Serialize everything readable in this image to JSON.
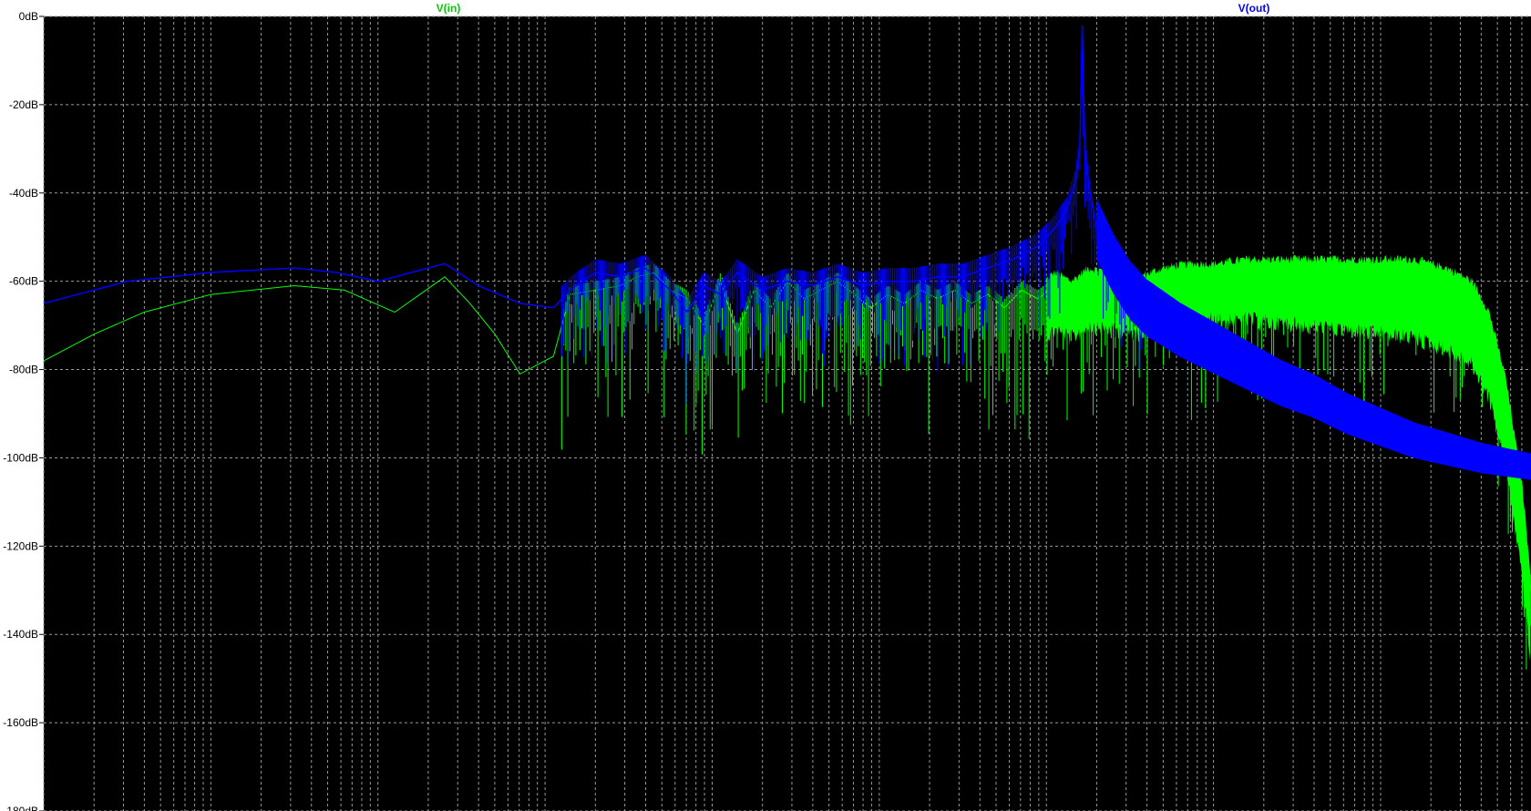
{
  "window": {
    "background": "#ffffff",
    "plot_background": "#000000",
    "grid_color": "#9a9a9a"
  },
  "chart_data": {
    "type": "line",
    "title": "",
    "xlabel": "",
    "ylabel": "",
    "x_scale": "log",
    "x_decade_range": [
      0,
      8.9
    ],
    "ylim": [
      -180,
      0
    ],
    "y_ticks": [
      0,
      -20,
      -40,
      -60,
      -80,
      -100,
      -120,
      -140,
      -160,
      -180
    ],
    "y_tick_labels": [
      "0dB",
      "-20dB",
      "-40dB",
      "-60dB",
      "-80dB",
      "-100dB",
      "-120dB",
      "-140dB",
      "-160dB",
      "-180dB"
    ],
    "grid": true,
    "series": [
      {
        "name": "V(in)",
        "color": "#00ff00",
        "points": [
          [
            0.0,
            -78
          ],
          [
            0.3,
            -72
          ],
          [
            0.6,
            -67
          ],
          [
            1.0,
            -63
          ],
          [
            1.5,
            -61
          ],
          [
            1.8,
            -62
          ],
          [
            2.1,
            -67
          ],
          [
            2.25,
            -63
          ],
          [
            2.4,
            -59
          ],
          [
            2.55,
            -65
          ],
          [
            2.7,
            -72
          ],
          [
            2.85,
            -81
          ],
          [
            2.95,
            -79
          ],
          [
            3.05,
            -77
          ],
          [
            3.15,
            -63
          ],
          [
            3.3,
            -62
          ],
          [
            3.45,
            -61
          ],
          [
            3.55,
            -59
          ],
          [
            3.65,
            -58
          ],
          [
            3.75,
            -62
          ],
          [
            3.85,
            -64
          ],
          [
            3.95,
            -70
          ],
          [
            4.05,
            -60
          ],
          [
            4.15,
            -72
          ],
          [
            4.25,
            -62
          ],
          [
            4.35,
            -66
          ],
          [
            4.45,
            -60
          ],
          [
            4.55,
            -64
          ],
          [
            4.65,
            -62
          ],
          [
            4.75,
            -60
          ],
          [
            4.85,
            -63
          ],
          [
            4.95,
            -66
          ],
          [
            5.05,
            -63
          ],
          [
            5.15,
            -65
          ],
          [
            5.25,
            -62
          ],
          [
            5.35,
            -64
          ],
          [
            5.45,
            -62
          ],
          [
            5.55,
            -65
          ],
          [
            5.65,
            -63
          ],
          [
            5.75,
            -66
          ],
          [
            5.85,
            -62
          ],
          [
            5.95,
            -64
          ],
          [
            6.05,
            -61
          ],
          [
            6.15,
            -63
          ],
          [
            6.25,
            -60
          ],
          [
            6.4,
            -61
          ],
          [
            6.55,
            -62
          ],
          [
            6.7,
            -60
          ],
          [
            6.85,
            -59
          ],
          [
            7.0,
            -59
          ],
          [
            7.2,
            -58
          ],
          [
            7.4,
            -58
          ],
          [
            7.6,
            -58
          ],
          [
            7.8,
            -58
          ],
          [
            8.0,
            -58
          ],
          [
            8.2,
            -58
          ],
          [
            8.4,
            -60
          ],
          [
            8.55,
            -63
          ],
          [
            8.65,
            -70
          ],
          [
            8.75,
            -85
          ],
          [
            8.85,
            -110
          ],
          [
            8.9,
            -130
          ]
        ],
        "noise_floor_start": 6.0,
        "noise_floor_end": 8.9
      },
      {
        "name": "V(out)",
        "color": "#0000ff",
        "points": [
          [
            0.0,
            -65
          ],
          [
            0.5,
            -60
          ],
          [
            1.0,
            -58
          ],
          [
            1.5,
            -57
          ],
          [
            1.75,
            -58
          ],
          [
            2.0,
            -60
          ],
          [
            2.2,
            -58
          ],
          [
            2.4,
            -56
          ],
          [
            2.6,
            -61
          ],
          [
            2.85,
            -65
          ],
          [
            3.05,
            -66
          ],
          [
            3.15,
            -62
          ],
          [
            3.3,
            -58
          ],
          [
            3.45,
            -59
          ],
          [
            3.6,
            -57
          ],
          [
            3.75,
            -62
          ],
          [
            3.85,
            -67
          ],
          [
            3.95,
            -61
          ],
          [
            4.05,
            -63
          ],
          [
            4.15,
            -58
          ],
          [
            4.3,
            -62
          ],
          [
            4.45,
            -60
          ],
          [
            4.6,
            -61
          ],
          [
            4.75,
            -59
          ],
          [
            4.9,
            -61
          ],
          [
            5.05,
            -60
          ],
          [
            5.2,
            -60
          ],
          [
            5.35,
            -59
          ],
          [
            5.5,
            -59
          ],
          [
            5.65,
            -57
          ],
          [
            5.8,
            -55
          ],
          [
            5.95,
            -52
          ],
          [
            6.05,
            -48
          ],
          [
            6.12,
            -44
          ],
          [
            6.17,
            -38
          ],
          [
            6.2,
            -30
          ],
          [
            6.215,
            -2
          ],
          [
            6.23,
            -30
          ],
          [
            6.26,
            -40
          ],
          [
            6.3,
            -48
          ],
          [
            6.4,
            -56
          ],
          [
            6.5,
            -62
          ],
          [
            6.6,
            -66
          ],
          [
            6.8,
            -71
          ],
          [
            7.0,
            -75
          ],
          [
            7.2,
            -79
          ],
          [
            7.4,
            -83
          ],
          [
            7.6,
            -86
          ],
          [
            7.8,
            -90
          ],
          [
            8.0,
            -93
          ],
          [
            8.2,
            -96
          ],
          [
            8.4,
            -98
          ],
          [
            8.6,
            -100
          ],
          [
            8.9,
            -102
          ]
        ]
      }
    ]
  }
}
